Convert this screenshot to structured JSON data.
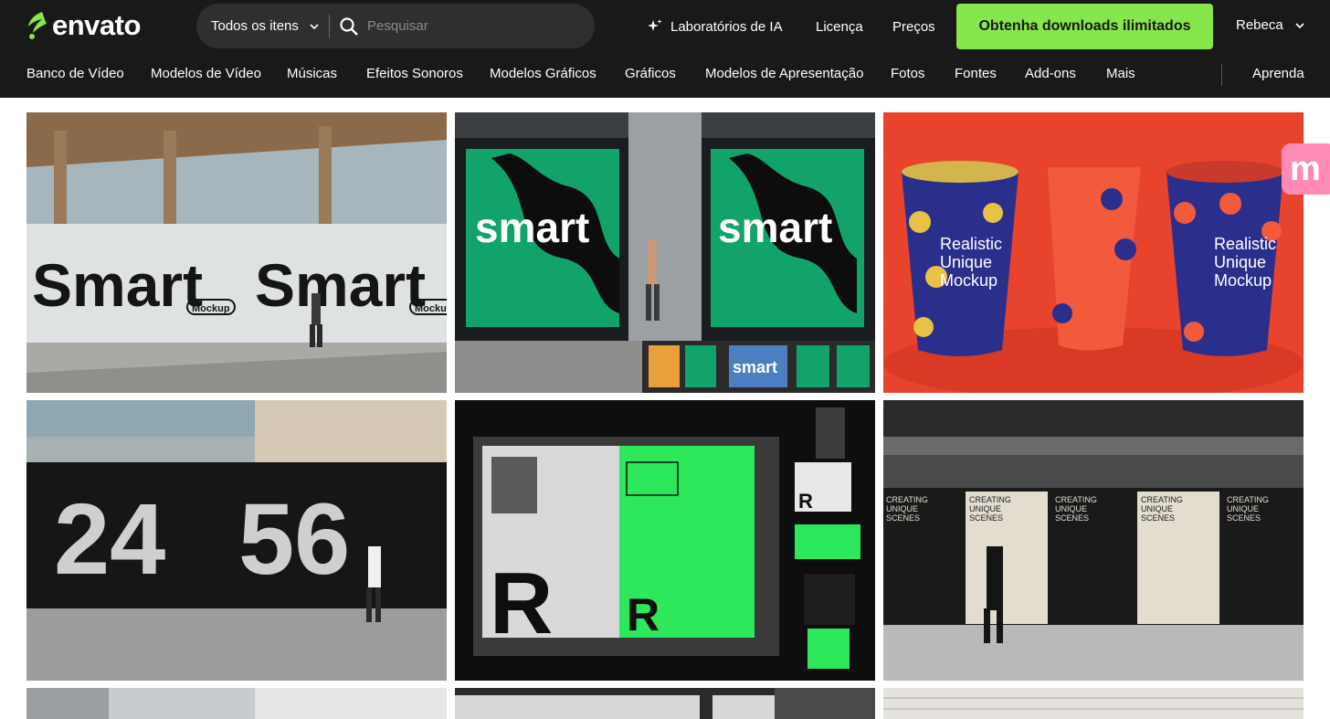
{
  "header": {
    "logo_text": "envato",
    "search": {
      "category": "Todos os itens",
      "placeholder": "Pesquisar"
    },
    "nav": {
      "ai_labs": "Laboratórios de IA",
      "license": "Licença",
      "pricing": "Preços"
    },
    "cta_label": "Obtenha downloads ilimitados",
    "user_name": "Rebeca"
  },
  "categories": [
    "Banco de Vídeo",
    "Modelos de Vídeo",
    "Músicas",
    "Efeitos Sonoros",
    "Modelos Gráficos",
    "Gráficos",
    "Modelos de Apresentação",
    "Fotos",
    "Fontes",
    "Add-ons",
    "Mais"
  ],
  "learn_label": "Aprenda",
  "tiles": {
    "t1": {
      "big1": "Smart",
      "big2": "Smart",
      "pill": "Mockup",
      "pill2": "Mockup"
    },
    "t2": {
      "word1": "smart",
      "word2": "smart",
      "thumb": "smart"
    },
    "t3": {
      "line1": "Realistic",
      "line2": "Unique",
      "line3": "Mockup"
    },
    "t4": {
      "num1": "24",
      "num2": "56"
    },
    "t5": {
      "letter": "R"
    },
    "t6": {
      "poster_line1": "CREATING",
      "poster_line2": "UNIQUE",
      "poster_line3": "SCENES"
    }
  },
  "badge_letter": "m",
  "colors": {
    "accent": "#87e64b",
    "topbar": "#191919",
    "badge": "#ff8ab5"
  }
}
